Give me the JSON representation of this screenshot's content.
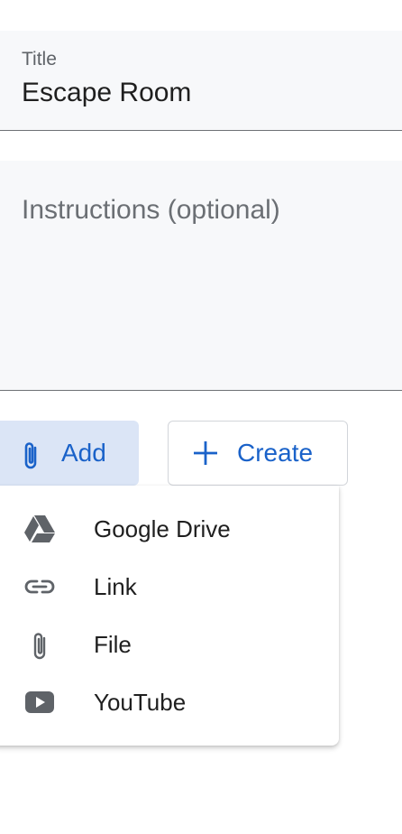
{
  "title_field": {
    "label": "Title",
    "value": "Escape Room"
  },
  "instructions_field": {
    "placeholder": "Instructions (optional)"
  },
  "actions": {
    "add_label": "Add",
    "create_label": "Create"
  },
  "add_menu": {
    "items": [
      {
        "label": "Google Drive",
        "icon": "google-drive-icon"
      },
      {
        "label": "Link",
        "icon": "link-icon"
      },
      {
        "label": "File",
        "icon": "paperclip-icon"
      },
      {
        "label": "YouTube",
        "icon": "youtube-icon"
      }
    ]
  },
  "colors": {
    "accent": "#1a62c9",
    "add_button_bg": "#dbe5f6",
    "field_bg": "#f7f8fa",
    "icon_gray": "#5f6368"
  }
}
